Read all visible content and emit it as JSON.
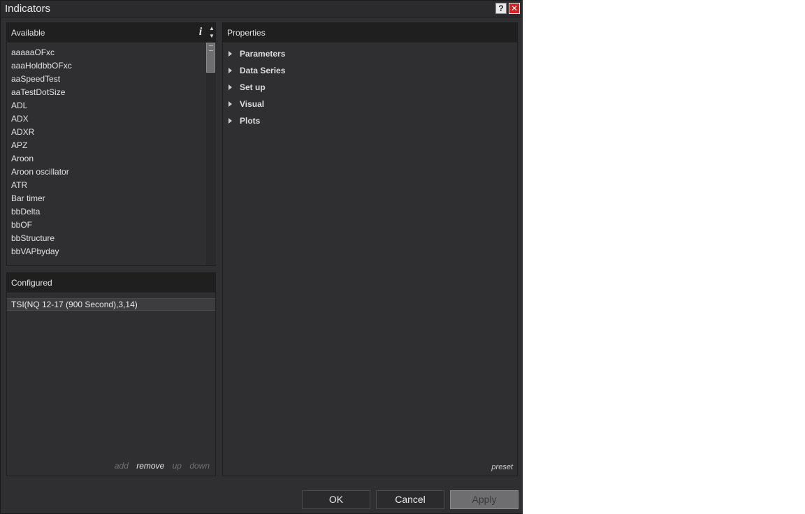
{
  "window": {
    "title": "Indicators"
  },
  "titlebar": {
    "help_label": "?",
    "close_label": "✕"
  },
  "available": {
    "header": "Available",
    "info_label": "i",
    "items": [
      "aaaaaOFxc",
      "aaaHoldbbOFxc",
      "aaSpeedTest",
      "aaTestDotSize",
      "ADL",
      "ADX",
      "ADXR",
      "APZ",
      "Aroon",
      "Aroon oscillator",
      "ATR",
      "Bar timer",
      "bbDelta",
      "bbOF",
      "bbStructure",
      "bbVAPbyday"
    ]
  },
  "configured": {
    "header": "Configured",
    "items": [
      "TSI(NQ 12-17 (900 Second),3,14)"
    ],
    "actions": {
      "add": "add",
      "remove": "remove",
      "up": "up",
      "down": "down"
    }
  },
  "properties": {
    "header": "Properties",
    "sections": [
      "Parameters",
      "Data Series",
      "Set up",
      "Visual",
      "Plots"
    ],
    "preset_label": "preset"
  },
  "buttons": {
    "ok": "OK",
    "cancel": "Cancel",
    "apply": "Apply"
  },
  "colors": {
    "window_bg": "#2f2f31",
    "header_bg": "#1f1f20",
    "text": "#e2e2e2",
    "close_red": "#d42020",
    "disabled_button": "#6e6e70"
  }
}
